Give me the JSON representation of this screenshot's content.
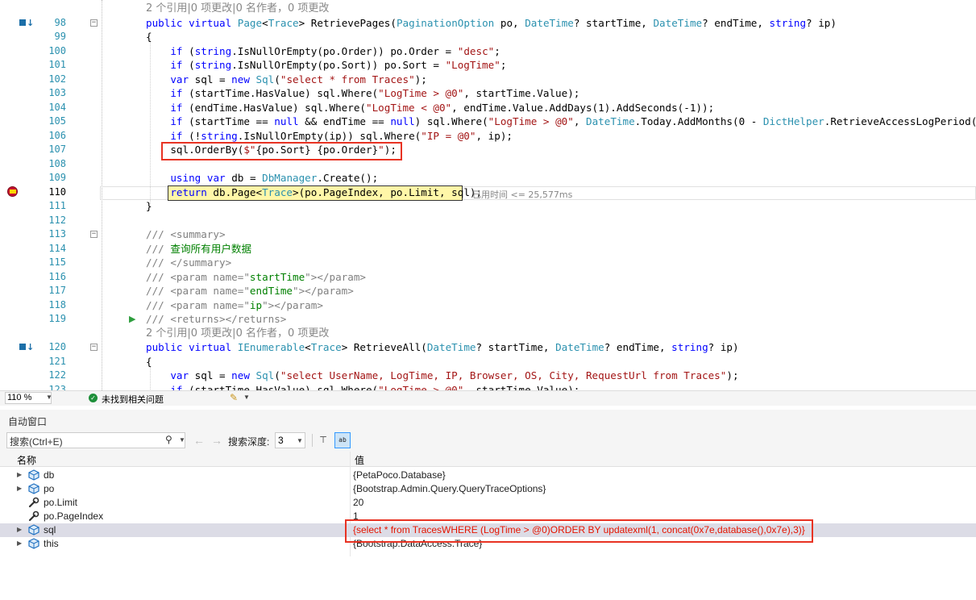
{
  "editor": {
    "lines": [
      {
        "kind": "lens",
        "text": "2 个引用|0 项更改|0 名作者，0 项更改"
      },
      {
        "num": "98",
        "glyph": "test",
        "fold": "−",
        "html": "<span class=\"k\">public</span> <span class=\"k\">virtual</span> <span class=\"t\">Page</span>&lt;<span class=\"t\">Trace</span>&gt; RetrievePages(<span class=\"t\">PaginationOption</span> po, <span class=\"t\">DateTime</span>? startTime, <span class=\"t\">DateTime</span>? endTime, <span class=\"k\">string</span>? ip)"
      },
      {
        "num": "99",
        "html": "{"
      },
      {
        "num": "100",
        "html": "    <span class=\"k\">if</span> (<span class=\"k\">string</span>.IsNullOrEmpty(po.Order)) po.Order = <span class=\"s\">\"desc\"</span>;"
      },
      {
        "num": "101",
        "html": "    <span class=\"k\">if</span> (<span class=\"k\">string</span>.IsNullOrEmpty(po.Sort)) po.Sort = <span class=\"s\">\"LogTime\"</span>;"
      },
      {
        "num": "102",
        "html": "    <span class=\"k\">var</span> sql = <span class=\"k\">new</span> <span class=\"t\">Sql</span>(<span class=\"s\">\"select * from Traces\"</span>);"
      },
      {
        "num": "103",
        "html": "    <span class=\"k\">if</span> (startTime.HasValue) sql.Where(<span class=\"s\">\"LogTime &gt; @0\"</span>, startTime.Value);"
      },
      {
        "num": "104",
        "html": "    <span class=\"k\">if</span> (endTime.HasValue) sql.Where(<span class=\"s\">\"LogTime &lt; @0\"</span>, endTime.Value.AddDays(1).AddSeconds(-1));"
      },
      {
        "num": "105",
        "html": "    <span class=\"k\">if</span> (startTime == <span class=\"k\">null</span> &amp;&amp; endTime == <span class=\"k\">null</span>) sql.Where(<span class=\"s\">\"LogTime &gt; @0\"</span>, <span class=\"t\">DateTime</span>.Today.AddMonths(0 - <span class=\"t\">DictHelper</span>.RetrieveAccessLogPeriod()));"
      },
      {
        "num": "106",
        "html": "    <span class=\"k\">if</span> (!<span class=\"k\">string</span>.IsNullOrEmpty(ip)) sql.Where(<span class=\"s\">\"IP = @0\"</span>, ip);"
      },
      {
        "num": "107",
        "html": "    sql.OrderBy(<span class=\"s\">$\"</span>{po.Sort} {po.Order}<span class=\"s\">\"</span>);"
      },
      {
        "num": "108",
        "html": ""
      },
      {
        "num": "109",
        "html": "    <span class=\"k\">using</span> <span class=\"k\">var</span> db = <span class=\"t\">DbManager</span>.Create();"
      },
      {
        "num": "110",
        "glyph": "bp",
        "current": true,
        "html": "    <span class=\"k\">return</span> db.Page&lt;<span class=\"t\">Trace</span>&gt;(po.PageIndex, po.Limit, sql);"
      },
      {
        "num": "111",
        "html": "}"
      },
      {
        "num": "112",
        "html": ""
      },
      {
        "num": "113",
        "fold": "−",
        "html": "<span class=\"g\">///</span> <span class=\"g\">&lt;summary&gt;</span>"
      },
      {
        "num": "114",
        "html": "<span class=\"g\">///</span> <span class=\"c\">查询所有用户数据</span>"
      },
      {
        "num": "115",
        "html": "<span class=\"g\">/// &lt;/summary&gt;</span>"
      },
      {
        "num": "116",
        "html": "<span class=\"g\">/// &lt;param name=\"</span><span class=\"c\">startTime</span><span class=\"g\">\"&gt;&lt;/param&gt;</span>"
      },
      {
        "num": "117",
        "html": "<span class=\"g\">/// &lt;param name=\"</span><span class=\"c\">endTime</span><span class=\"g\">\"&gt;&lt;/param&gt;</span>"
      },
      {
        "num": "118",
        "html": "<span class=\"g\">/// &lt;param name=\"</span><span class=\"c\">ip</span><span class=\"g\">\"&gt;&lt;/param&gt;</span>"
      },
      {
        "num": "119",
        "glyph": "run",
        "html": "<span class=\"g\">/// &lt;returns&gt;&lt;/returns&gt;</span>"
      },
      {
        "kind": "lens",
        "text": "2 个引用|0 项更改|0 名作者，0 项更改"
      },
      {
        "num": "120",
        "glyph": "test",
        "fold": "−",
        "html": "<span class=\"k\">public</span> <span class=\"k\">virtual</span> <span class=\"t\">IEnumerable</span>&lt;<span class=\"t\">Trace</span>&gt; RetrieveAll(<span class=\"t\">DateTime</span>? startTime, <span class=\"t\">DateTime</span>? endTime, <span class=\"k\">string</span>? ip)"
      },
      {
        "num": "121",
        "html": "{"
      },
      {
        "num": "122",
        "html": "    <span class=\"k\">var</span> sql = <span class=\"k\">new</span> <span class=\"t\">Sql</span>(<span class=\"s\">\"select UserName, LogTime, IP, Browser, OS, City, RequestUrl from Traces\"</span>);"
      },
      {
        "num": "123",
        "html": "    <span class=\"k\">if</span> (startTime.HasValue) sql.Where(<span class=\"s\">\"LogTime &gt; @0\"</span>, startTime.Value);"
      }
    ],
    "elapsed": "已用时间 <= 25,577ms"
  },
  "statusbar": {
    "zoom": "110 %",
    "issues": "未找到相关问题"
  },
  "autos": {
    "title": "自动窗口",
    "search_placeholder": "搜索(Ctrl+E)",
    "depth_label": "搜索深度:",
    "depth_value": "3",
    "col_name": "名称",
    "col_value": "值",
    "rows": [
      {
        "name": "db",
        "value": "{PetaPoco.Database}",
        "icon": "object-icon",
        "expandable": true
      },
      {
        "name": "po",
        "value": "{Bootstrap.Admin.Query.QueryTraceOptions}",
        "icon": "object-icon",
        "expandable": true
      },
      {
        "name": "po.Limit",
        "value": "20",
        "icon": "wrench-icon",
        "expandable": false
      },
      {
        "name": "po.PageIndex",
        "value": "1",
        "icon": "wrench-icon",
        "expandable": false
      },
      {
        "name": "sql",
        "value": "{select * from TracesWHERE (LogTime > @0)ORDER BY updatexml(1, concat(0x7e,database(),0x7e),3)}",
        "icon": "object-icon",
        "expandable": true,
        "selected": true,
        "changed": true
      },
      {
        "name": "this",
        "value": "{Bootstrap.DataAccess.Trace}",
        "icon": "object-icon",
        "expandable": true
      }
    ]
  },
  "colors": {
    "keyword": "#0000ff",
    "type": "#2b91af",
    "string": "#a31515",
    "comment": "#008000",
    "highlight": "#e83323"
  }
}
